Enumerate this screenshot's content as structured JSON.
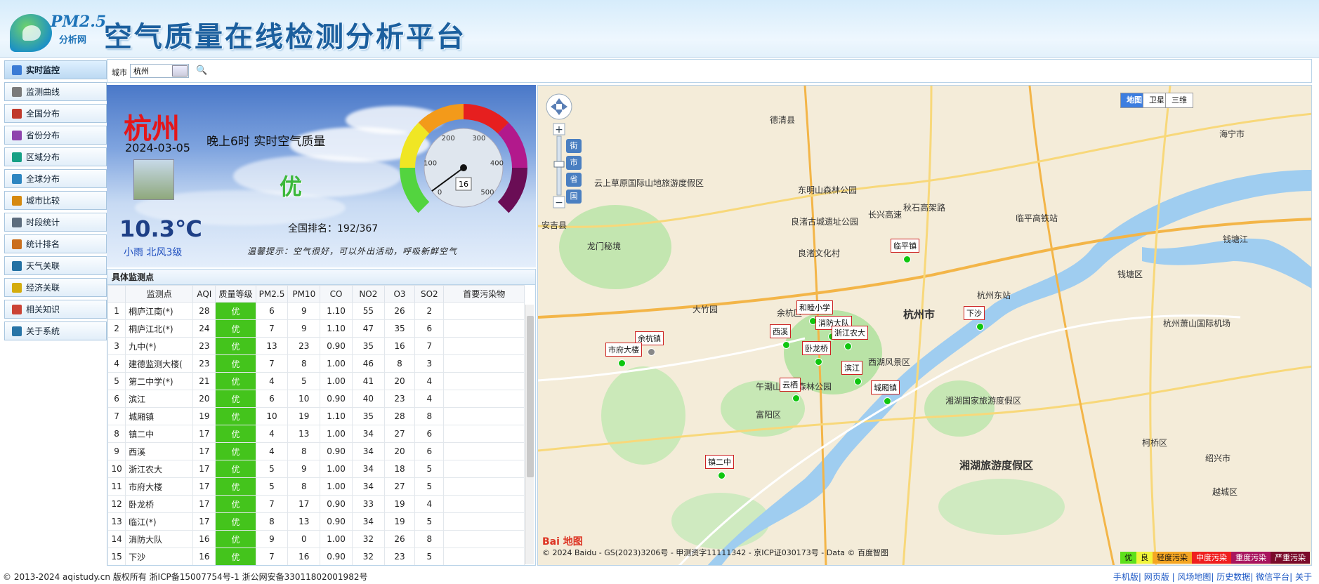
{
  "header": {
    "logo_main": "PM2.5",
    "logo_sub": "分析网",
    "title": "空气质量在线检测分析平台"
  },
  "sidebar": {
    "items": [
      {
        "label": "实时监控",
        "icon": "monitor-icon",
        "color": "#3a7bd5"
      },
      {
        "label": "监测曲线",
        "icon": "curve-chart-icon",
        "color": "#7a7a7a"
      },
      {
        "label": "全国分布",
        "icon": "china-map-icon",
        "color": "#c0392b"
      },
      {
        "label": "省份分布",
        "icon": "province-map-icon",
        "color": "#8e44ad"
      },
      {
        "label": "区域分布",
        "icon": "region-map-icon",
        "color": "#16a085"
      },
      {
        "label": "全球分布",
        "icon": "globe-icon",
        "color": "#2e86c1"
      },
      {
        "label": "城市比较",
        "icon": "compare-icon",
        "color": "#d68910"
      },
      {
        "label": "时段统计",
        "icon": "clock-icon",
        "color": "#5d6d7e"
      },
      {
        "label": "统计排名",
        "icon": "rank-icon",
        "color": "#ca6f1e"
      },
      {
        "label": "天气关联",
        "icon": "weather-icon",
        "color": "#2471a3"
      },
      {
        "label": "经济关联",
        "icon": "coin-icon",
        "color": "#d4ac0d"
      },
      {
        "label": "相关知识",
        "icon": "book-icon",
        "color": "#cb4335"
      },
      {
        "label": "关于系统",
        "icon": "info-icon",
        "color": "#2874a6"
      }
    ]
  },
  "search": {
    "label": "城市",
    "value": "杭州",
    "button_icon": "search-icon"
  },
  "weather": {
    "city": "杭州",
    "date": "2024-03-05",
    "temperature": "10.3℃",
    "wind": "小雨 北风3级",
    "time_title": "晚上6时 实时空气质量",
    "quality": "优",
    "aqi": "16",
    "rank": "全国排名：192/367",
    "tip": "温馨提示：空气很好，可以外出活动，呼吸新鲜空气",
    "gauge_ticks": [
      "0",
      "100",
      "200",
      "300",
      "400",
      "500"
    ],
    "gauge_value": 16,
    "gauge_max": 500
  },
  "stations": {
    "title": "具体监测点",
    "columns": [
      "",
      "监测点",
      "AQI",
      "质量等级",
      "PM2.5",
      "PM10",
      "CO",
      "NO2",
      "O3",
      "SO2",
      "首要污染物"
    ],
    "rows": [
      [
        "1",
        "桐庐江南(*)",
        "28",
        "优",
        "6",
        "9",
        "1.10",
        "55",
        "26",
        "2",
        ""
      ],
      [
        "2",
        "桐庐江北(*)",
        "24",
        "优",
        "7",
        "9",
        "1.10",
        "47",
        "35",
        "6",
        ""
      ],
      [
        "3",
        "九中(*)",
        "23",
        "优",
        "13",
        "23",
        "0.90",
        "35",
        "16",
        "7",
        ""
      ],
      [
        "4",
        "建德监测大楼(",
        "23",
        "优",
        "7",
        "8",
        "1.00",
        "46",
        "8",
        "3",
        ""
      ],
      [
        "5",
        "第二中学(*)",
        "21",
        "优",
        "4",
        "5",
        "1.00",
        "41",
        "20",
        "4",
        ""
      ],
      [
        "6",
        "滨江",
        "20",
        "优",
        "6",
        "10",
        "0.90",
        "40",
        "23",
        "4",
        ""
      ],
      [
        "7",
        "城厢镇",
        "19",
        "优",
        "10",
        "19",
        "1.10",
        "35",
        "28",
        "8",
        ""
      ],
      [
        "8",
        "镇二中",
        "17",
        "优",
        "4",
        "13",
        "1.00",
        "34",
        "27",
        "6",
        ""
      ],
      [
        "9",
        "西溪",
        "17",
        "优",
        "4",
        "8",
        "0.90",
        "34",
        "20",
        "6",
        ""
      ],
      [
        "10",
        "浙江农大",
        "17",
        "优",
        "5",
        "9",
        "1.00",
        "34",
        "18",
        "5",
        ""
      ],
      [
        "11",
        "市府大楼",
        "17",
        "优",
        "5",
        "8",
        "1.00",
        "34",
        "27",
        "5",
        ""
      ],
      [
        "12",
        "卧龙桥",
        "17",
        "优",
        "7",
        "17",
        "0.90",
        "33",
        "19",
        "4",
        ""
      ],
      [
        "13",
        "临江(*)",
        "17",
        "优",
        "8",
        "13",
        "0.90",
        "34",
        "19",
        "5",
        ""
      ],
      [
        "14",
        "消防大队",
        "16",
        "优",
        "9",
        "0",
        "1.00",
        "32",
        "26",
        "8",
        ""
      ],
      [
        "15",
        "下沙",
        "16",
        "优",
        "7",
        "16",
        "0.90",
        "32",
        "23",
        "5",
        ""
      ]
    ]
  },
  "map": {
    "types": [
      "地图",
      "卫星",
      "三维"
    ],
    "active_type": "地图",
    "side_buttons": [
      "街",
      "市",
      "省",
      "国"
    ],
    "places": [
      "德清县",
      "海宁市",
      "长兴高速",
      "秋石高架路",
      "钱塘区",
      "钱塘江",
      "杭州东站",
      "杭州市",
      "余杭区",
      "西湖风景区",
      "良渚古城遗址公园",
      "良渚文化村",
      "东明山森林公园",
      "午潮山国家森林公园",
      "湘湖国家旅游度假区",
      "柯桥区",
      "绍兴市",
      "越城区",
      "杭州萧山国际机场",
      "湘湖旅游度假区",
      "大竹园",
      "富阳区",
      "临平高铁站",
      "龙门秘境",
      "云上草原国际山地旅游度假区",
      "安吉县"
    ],
    "stations": [
      {
        "name": "临平镇",
        "status": "good"
      },
      {
        "name": "下沙",
        "status": "good"
      },
      {
        "name": "和睦小学",
        "status": "good"
      },
      {
        "name": "消防大队",
        "status": "good"
      },
      {
        "name": "浙江农大",
        "status": "good"
      },
      {
        "name": "西溪",
        "status": "good"
      },
      {
        "name": "余杭镇",
        "status": "none"
      },
      {
        "name": "市府大楼",
        "status": "good"
      },
      {
        "name": "卧龙桥",
        "status": "good"
      },
      {
        "name": "滨江",
        "status": "good"
      },
      {
        "name": "云栖",
        "status": "good"
      },
      {
        "name": "城厢镇",
        "status": "good"
      },
      {
        "name": "镇二中",
        "status": "good"
      }
    ],
    "copyright": "© 2024 Baidu - GS(2023)3206号 - 甲测资字11111342 - 京ICP证030173号 - Data © 百度智图",
    "logo_text": "Bai 地图",
    "legend": [
      {
        "label": "优",
        "color": "#5ee01c"
      },
      {
        "label": "良",
        "color": "#f1f53c"
      },
      {
        "label": "轻度污染",
        "color": "#f5a623"
      },
      {
        "label": "中度污染",
        "color": "#ef1f1f"
      },
      {
        "label": "重度污染",
        "color": "#a8155e"
      },
      {
        "label": "严重污染",
        "color": "#7a0b2a"
      }
    ]
  },
  "footer": {
    "left": "© 2013-2024 aqistudy.cn 版权所有 浙ICP备15007754号-1 浙公网安备33011802001982号",
    "right": "手机版| 网页版 | 风场地图| 历史数据| 微信平台| 关于"
  }
}
